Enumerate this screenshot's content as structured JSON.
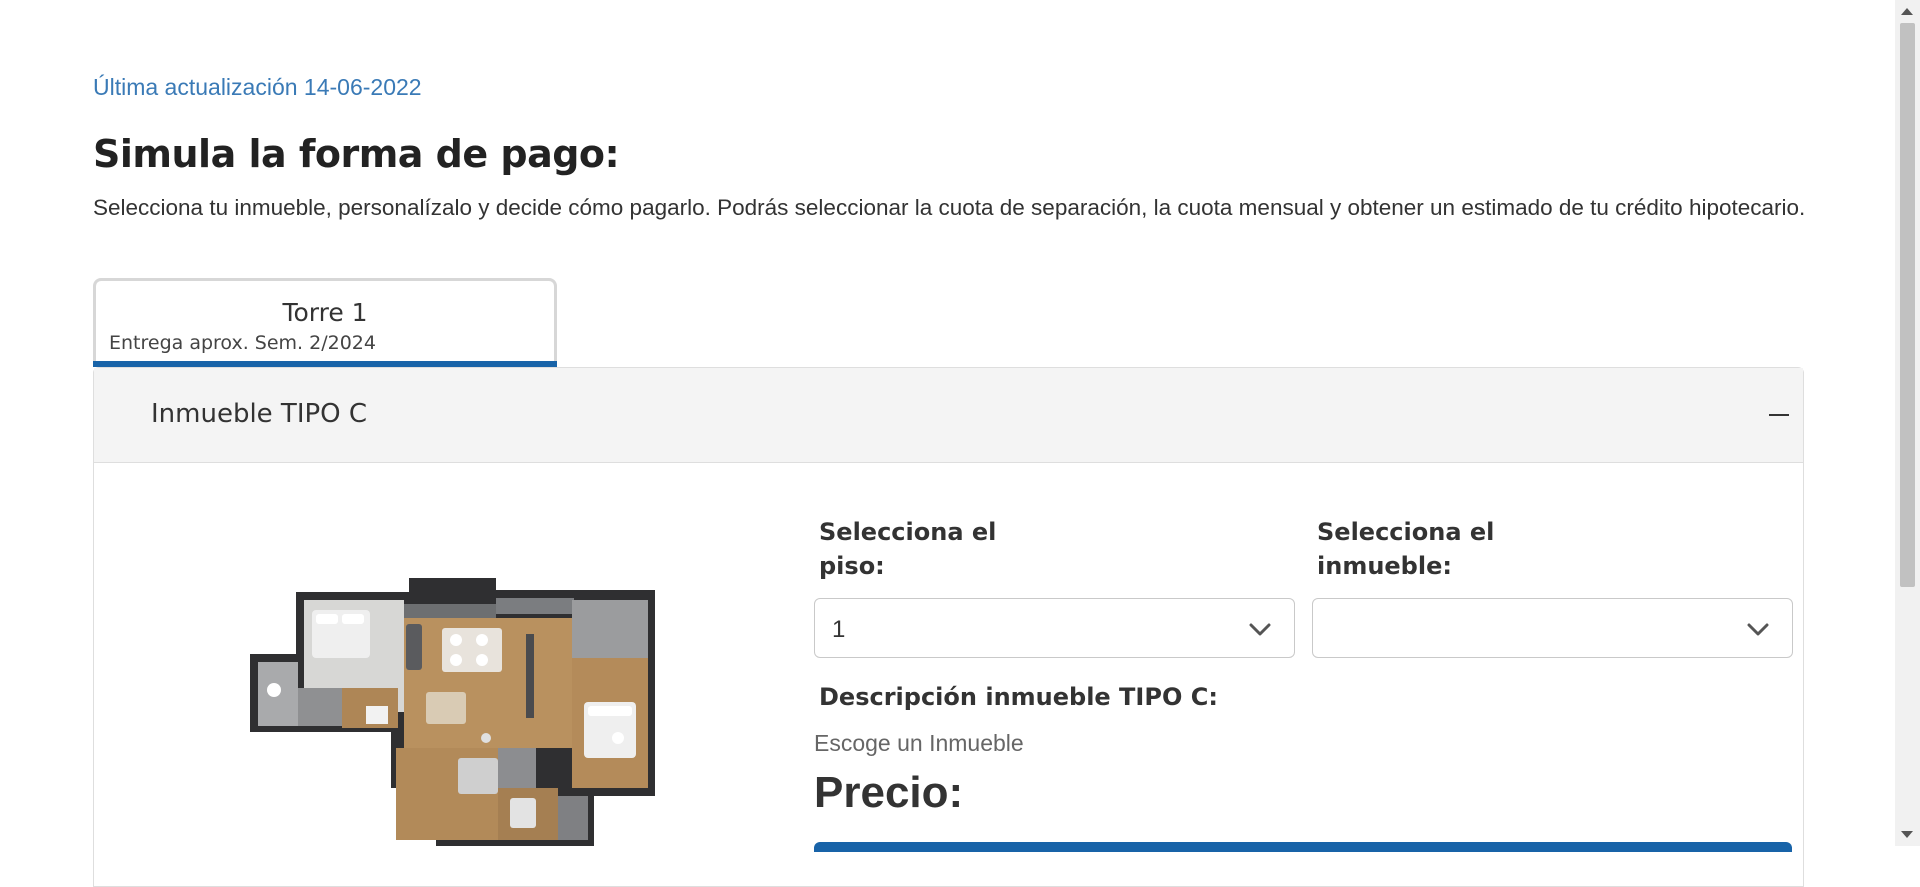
{
  "header": {
    "last_update": "Última actualización 14-06-2022",
    "title": "Simula la forma de pago:",
    "description": "Selecciona tu inmueble, personalízalo y decide cómo pagarlo. Podrás seleccionar la cuota de separación, la cuota mensual y obtener un estimado de tu crédito hipotecario."
  },
  "tabs": [
    {
      "label": "Torre 1",
      "sublabel": "Entrega aprox. Sem. 2/2024",
      "active": true
    }
  ],
  "panel": {
    "title": "Inmueble TIPO C",
    "floor_select": {
      "label": "Selecciona el piso:",
      "value": "1"
    },
    "unit_select": {
      "label": "Selecciona el inmueble:",
      "value": ""
    },
    "description_label": "Descripción inmueble TIPO C:",
    "description_placeholder": "Escoge un Inmueble",
    "price_label": "Precio:"
  },
  "colors": {
    "accent": "#1863a8",
    "link": "#3a7ab6",
    "panel_header_bg": "#f4f4f4"
  },
  "icons": [
    "collapse-icon",
    "chevron-down-icon",
    "floorplan-image"
  ]
}
